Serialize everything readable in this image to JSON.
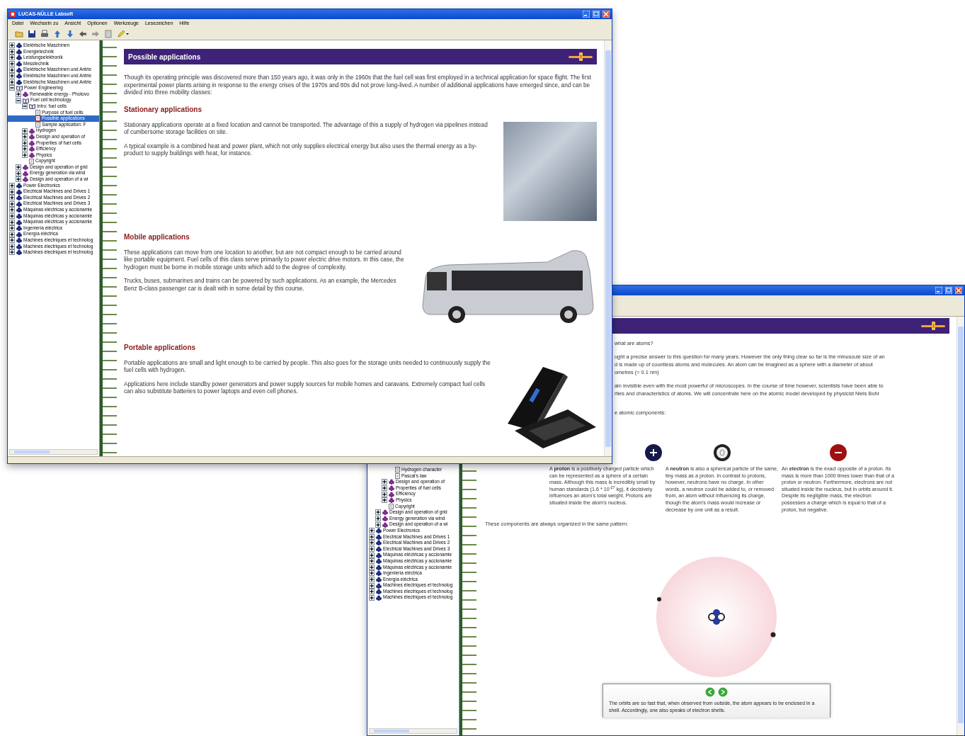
{
  "window_main": {
    "title": "LUCAS-NÜLLE Labsoft",
    "menu": [
      "Datei",
      "Wechseln zu",
      "Ansicht",
      "Optionen",
      "Werkzeuge",
      "Lesezeichen",
      "Hilfe"
    ],
    "sidebar": {
      "tree": [
        {
          "label": "Elektrische Maschinen",
          "kind": "folder",
          "expanded": false,
          "selected": false
        },
        {
          "label": "Energietechnik",
          "kind": "folder",
          "expanded": false,
          "selected": false
        },
        {
          "label": "Leistungselektronik",
          "kind": "folder",
          "expanded": false,
          "selected": false
        },
        {
          "label": "Messtechnik",
          "kind": "folder",
          "expanded": false,
          "selected": false
        },
        {
          "label": "Elektrische Maschinen und Antrie",
          "kind": "folder",
          "expanded": false,
          "selected": false
        },
        {
          "label": "Elektrische Maschinen und Antrie",
          "kind": "folder",
          "expanded": false,
          "selected": false
        },
        {
          "label": "Elektrische Maschinen und Antrie",
          "kind": "folder",
          "expanded": false,
          "selected": false
        },
        {
          "label": "Power Engineering",
          "kind": "book",
          "expanded": true,
          "selected": false,
          "children": [
            {
              "label": "Renewable energy - Photovo",
              "kind": "topic",
              "expanded": false,
              "selected": false
            },
            {
              "label": "Fuel cell technology",
              "kind": "book",
              "expanded": true,
              "selected": false,
              "children": [
                {
                  "label": "Intro: fuel cells",
                  "kind": "book",
                  "expanded": true,
                  "selected": false,
                  "children": [
                    {
                      "label": "Purpose of fuel cells",
                      "kind": "page",
                      "selected": false
                    },
                    {
                      "label": "Possible applications",
                      "kind": "page",
                      "selected": true
                    },
                    {
                      "label": "Sample application: F",
                      "kind": "page",
                      "selected": false
                    }
                  ]
                },
                {
                  "label": "Hydrogen",
                  "kind": "topic",
                  "expanded": false,
                  "selected": false
                },
                {
                  "label": "Design and operation of",
                  "kind": "topic",
                  "expanded": false,
                  "selected": false
                },
                {
                  "label": "Properties of fuel cells",
                  "kind": "topic",
                  "expanded": false,
                  "selected": false
                },
                {
                  "label": "Efficiency",
                  "kind": "topic",
                  "expanded": false,
                  "selected": false
                },
                {
                  "label": "Physics",
                  "kind": "topic",
                  "expanded": false,
                  "selected": false
                },
                {
                  "label": "Copyright",
                  "kind": "page",
                  "selected": false
                }
              ]
            },
            {
              "label": "Design and operation of grid",
              "kind": "topic",
              "expanded": false,
              "selected": false
            },
            {
              "label": "Energy generation via wind",
              "kind": "topic",
              "expanded": false,
              "selected": false
            },
            {
              "label": "Design and operation of a wi",
              "kind": "topic",
              "expanded": false,
              "selected": false
            }
          ]
        },
        {
          "label": "Power Electronics",
          "kind": "folder",
          "expanded": false,
          "selected": false
        },
        {
          "label": "Electrical Machines and Drives 1",
          "kind": "folder",
          "expanded": false,
          "selected": false
        },
        {
          "label": "Electrical Machines and Drives 2",
          "kind": "folder",
          "expanded": false,
          "selected": false
        },
        {
          "label": "Electrical Machines and Drives 3",
          "kind": "folder",
          "expanded": false,
          "selected": false
        },
        {
          "label": "Máquinas eléctricas y accionamie",
          "kind": "folder",
          "expanded": false,
          "selected": false
        },
        {
          "label": "Máquinas eléctricas y accionamie",
          "kind": "folder",
          "expanded": false,
          "selected": false
        },
        {
          "label": "Máquinas eléctricas y accionamie",
          "kind": "folder",
          "expanded": false,
          "selected": false
        },
        {
          "label": "Ingeniería eléctrica",
          "kind": "folder",
          "expanded": false,
          "selected": false
        },
        {
          "label": "Energía eléctrica",
          "kind": "folder",
          "expanded": false,
          "selected": false
        },
        {
          "label": "Machines électriques et technolog",
          "kind": "folder",
          "expanded": false,
          "selected": false
        },
        {
          "label": "Machines électriques et technolog",
          "kind": "folder",
          "expanded": false,
          "selected": false
        },
        {
          "label": "Machines électriques et technolog",
          "kind": "folder",
          "expanded": false,
          "selected": false
        }
      ]
    },
    "content": {
      "title": "Possible applications",
      "intro": "Though its operating principle was discovered more than 150 years ago, it was only in the 1960s that the fuel cell was first employed in a technical application for space flight. The first experimental power plants arising in response to the energy crises of the 1970s and 80s did not prove long-lived. A number of additional applications have emerged since, and can be divided into three mobility classes:",
      "sections": [
        {
          "heading": "Stationary applications",
          "kind": "photo",
          "paragraphs": [
            "Stationary applications operate at a fixed location and cannot be transported. The advantage of this a supply of hydrogen via pipelines instead of cumbersome storage facilities on site.",
            "A typical example is a combined heat and power plant, which not only supplies electrical energy but also uses the thermal energy as a by-product to supply buildings with heat, for instance."
          ]
        },
        {
          "heading": "Mobile applications",
          "kind": "bus",
          "paragraphs": [
            "These applications can move from one location to another, but are not compact enough to be carried around like portable equipment. Fuel cells of this class serve primarily to power electric drive motors. In this case, the hydrogen must be borne in mobile storage units which add to the degree of complexity.",
            "Trucks, buses, submarines and trains can be powered by such applications. As an example, the Mercedes Benz B-class passenger car is dealt with in some detail by this course."
          ]
        },
        {
          "heading": "Portable applications",
          "kind": "laptop",
          "paragraphs": [
            "Portable applications are small and light enough to be carried by people. This also goes for the storage units needed to continuously supply the fuel cells with hydrogen.",
            "Applications here include standby power generators and power supply sources for mobile homes and caravans. Extremely compact fuel cells can also substitute batteries to power laptops and even cell phones."
          ]
        }
      ]
    }
  },
  "window_back": {
    "sidebar": {
      "tree": [
        {
          "children": [
            {
              "children": [
                {
                  "children": [
                    {
                      "label": "Hydrogen character",
                      "kind": "page"
                    },
                    {
                      "label": "Pascal's law",
                      "kind": "page"
                    }
                  ]
                },
                {
                  "label": "Design and operation of",
                  "kind": "topic",
                  "expanded": false
                },
                {
                  "label": "Properties of fuel cells",
                  "kind": "topic",
                  "expanded": false
                },
                {
                  "label": "Efficiency",
                  "kind": "topic",
                  "expanded": false
                },
                {
                  "label": "Physics",
                  "kind": "topic",
                  "expanded": false
                },
                {
                  "label": "Copyright",
                  "kind": "page"
                }
              ]
            },
            {
              "label": "Design and operation of grid",
              "kind": "topic",
              "expanded": false
            },
            {
              "label": "Energy generation via wind",
              "kind": "topic",
              "expanded": false
            },
            {
              "label": "Design and operation of a wi",
              "kind": "topic",
              "expanded": false
            }
          ]
        },
        {
          "label": "Power Electronics",
          "kind": "folder",
          "expanded": false
        },
        {
          "label": "Electrical Machines and Drives 1",
          "kind": "folder",
          "expanded": false
        },
        {
          "label": "Electrical Machines and Drives 2",
          "kind": "folder",
          "expanded": false
        },
        {
          "label": "Electrical Machines and Drives 3",
          "kind": "folder",
          "expanded": false
        },
        {
          "label": "Máquinas eléctricas y accionamie",
          "kind": "folder",
          "expanded": false
        },
        {
          "label": "Máquinas eléctricas y accionamie",
          "kind": "folder",
          "expanded": false
        },
        {
          "label": "Máquinas eléctricas y accionamie",
          "kind": "folder",
          "expanded": false
        },
        {
          "label": "Ingeniería eléctrica",
          "kind": "folder",
          "expanded": false
        },
        {
          "label": "Energía eléctrica",
          "kind": "folder",
          "expanded": false
        },
        {
          "label": "Machines électriques et technolog",
          "kind": "folder",
          "expanded": false
        },
        {
          "label": "Machines électriques et technolog",
          "kind": "folder",
          "expanded": false
        },
        {
          "label": "Machines électriques et technolog",
          "kind": "folder",
          "expanded": false
        }
      ]
    },
    "content": {
      "blocks": [
        [
          "what are atoms?"
        ],
        [
          "ught a precise answer to this question for many years. However the only thing clear so far is the minuscule size of an",
          "d is made up of countless atoms and molecules. An atom can be imagined as a sphere with a diameter of about",
          "ometres (= 0.1 nm)"
        ],
        [
          "ain invisible even with the most powerful of microscopes. In the course of time however, scientists have been able to",
          "rties and characteristics of atoms. We will concentrate here on the atomic model developed by physicist Niels Bohr"
        ],
        [
          "e atomic components:"
        ]
      ],
      "particles": [
        {
          "kind": "proton",
          "text": "A **proton** is a positively charged particle which can be represented as a sphere of a certain mass. Although this mass is incredibly small by human standards (1.6 * 10$^{-27}$ kg), it decisively influences an atom's total weight. Protons are situated inside the atom's nucleus."
        },
        {
          "kind": "neutron",
          "text": "A **neutron** is also a spherical particle of the same, tiny mass as a proton. In contrast to protons, however, neutrons have no charge. In other words, a neutron could be added to, or removed from, an atom without influencing its charge, though the atom's mass would increase or decrease by one unit as a result."
        },
        {
          "kind": "electron",
          "text": "An **electron** is the exact opposite of a proton. Its mass is more than 1000 times lower than that of a proton or neutron. Furthermore, electrons are not situated inside the nucleus, but in orbits around it. Despite its negligible mass, the electron possesses a charge which is equal to that of a proton, but negative."
        }
      ],
      "pattern_text": "These components are always organized in the same pattern:",
      "popup": {
        "text": "The orbits are so fast that, when observed from outside, the atom appears to be enclosed in a shell. Accordingly, one also speaks of electron shells."
      }
    }
  }
}
